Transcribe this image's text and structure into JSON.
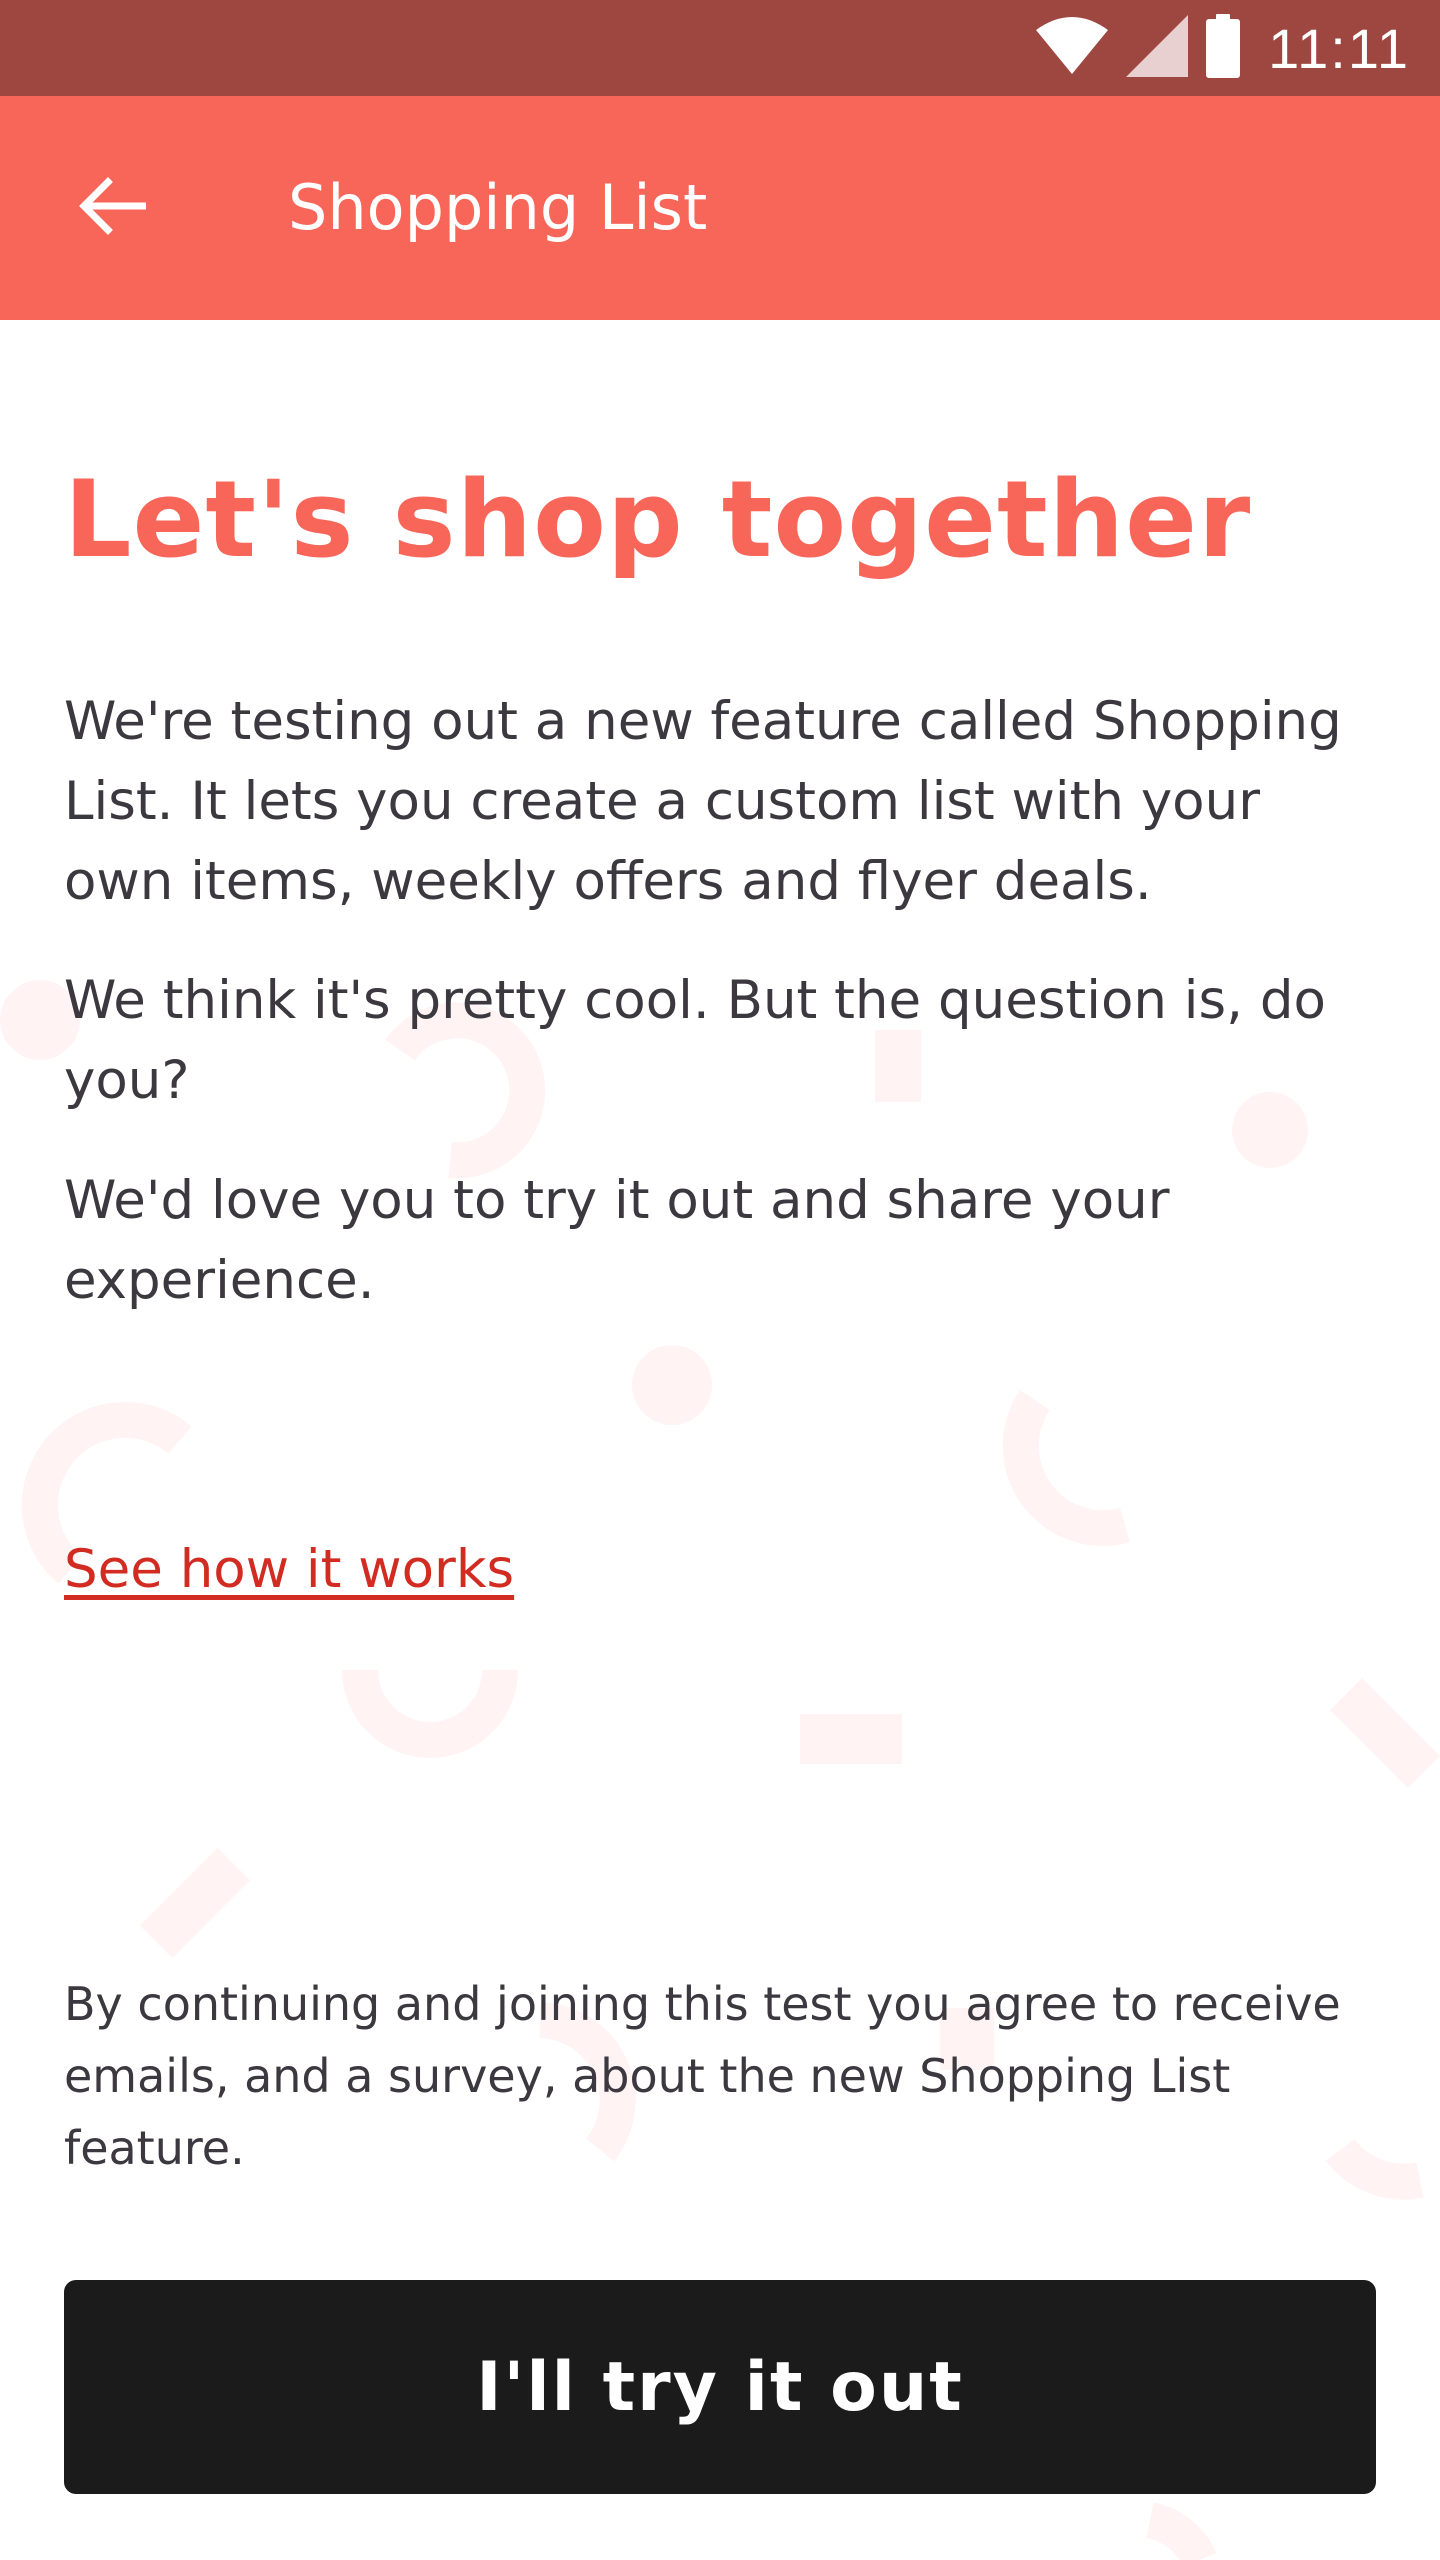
{
  "status_bar": {
    "time": "11:11",
    "icons": [
      "wifi-icon",
      "signal-icon",
      "battery-icon"
    ]
  },
  "app_bar": {
    "back_icon": "arrow-left-icon",
    "title": "Shopping List"
  },
  "main": {
    "headline": "Let's shop together",
    "paragraphs": [
      "We're testing out a new feature called Shopping List. It lets you create a custom list with your own items, weekly offers and flyer deals.",
      "We think it's pretty cool. But the question is, do you?",
      "We'd love you to try it out and share your experience."
    ],
    "link_label": "See how it works",
    "disclaimer": "By continuing and joining this test you agree to receive emails, and a survey, about the new Shopping List feature.",
    "cta_label": "I'll try it out"
  },
  "colors": {
    "status_bar": "#9e4640",
    "brand": "#f8665a",
    "link": "#d22b22",
    "button": "#1b1b1b",
    "body_text": "#3b383f"
  }
}
